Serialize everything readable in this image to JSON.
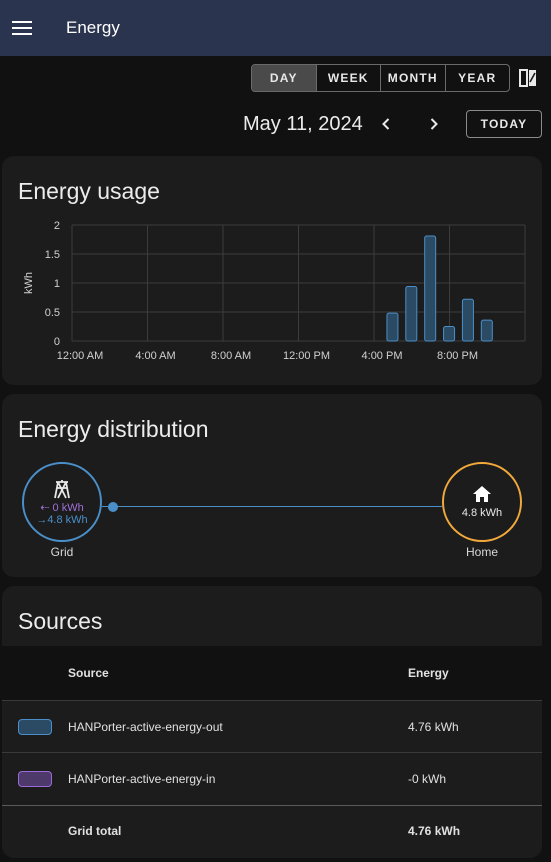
{
  "app": {
    "title": "Energy"
  },
  "period": {
    "options": [
      "DAY",
      "WEEK",
      "MONTH",
      "YEAR"
    ],
    "selected": "DAY"
  },
  "date": {
    "label": "May 11, 2024",
    "today_label": "TODAY"
  },
  "usage": {
    "title": "Energy usage",
    "chart_data": {
      "type": "bar",
      "title": "Energy usage",
      "ylabel": "kWh",
      "xlabel": "",
      "ylim": [
        0,
        2
      ],
      "yticks": [
        "0",
        "0.5",
        "1",
        "1.5",
        "2"
      ],
      "xtick_labels": [
        "12:00 AM",
        "4:00 AM",
        "8:00 AM",
        "12:00 PM",
        "4:00 PM",
        "8:00 PM"
      ],
      "categories": [
        "12:00 AM",
        "1:00 AM",
        "2:00 AM",
        "3:00 AM",
        "4:00 AM",
        "5:00 AM",
        "6:00 AM",
        "7:00 AM",
        "8:00 AM",
        "9:00 AM",
        "10:00 AM",
        "11:00 AM",
        "12:00 PM",
        "1:00 PM",
        "2:00 PM",
        "3:00 PM",
        "4:00 PM",
        "5:00 PM",
        "6:00 PM",
        "7:00 PM",
        "8:00 PM",
        "9:00 PM",
        "10:00 PM",
        "11:00 PM"
      ],
      "values": [
        0,
        0,
        0,
        0,
        0,
        0,
        0,
        0,
        0,
        0,
        0,
        0,
        0,
        0,
        0,
        0,
        0.48,
        0.94,
        1.81,
        0.25,
        0.72,
        0.36,
        0,
        0
      ],
      "grid": true,
      "color": "#4a8fc9"
    }
  },
  "distribution": {
    "title": "Energy distribution",
    "grid": {
      "label": "Grid",
      "in_value": "0 kWh",
      "out_value": "4.8 kWh"
    },
    "home": {
      "label": "Home",
      "value": "4.8 kWh"
    }
  },
  "sources": {
    "title": "Sources",
    "headers": {
      "source": "Source",
      "energy": "Energy"
    },
    "rows": [
      {
        "name": "HANPorter-active-energy-out",
        "energy": "4.76 kWh",
        "color": "#4a8fc9"
      },
      {
        "name": "HANPorter-active-energy-in",
        "energy": "-0 kWh",
        "color": "#9a6ad8"
      }
    ],
    "total": {
      "label": "Grid total",
      "energy": "4.76 kWh"
    }
  }
}
